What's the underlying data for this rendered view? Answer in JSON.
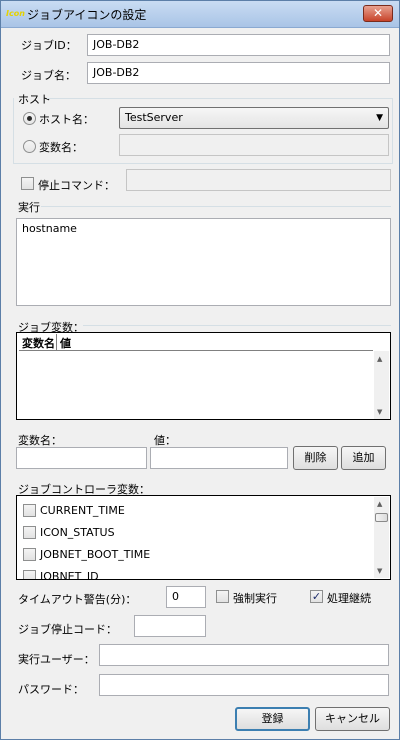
{
  "window": {
    "title": "ジョブアイコンの設定",
    "icon_text": "Icon",
    "close_label": "✕"
  },
  "job_id": {
    "label": "ジョブID：",
    "value": "JOB-DB2"
  },
  "job_name": {
    "label": "ジョブ名：",
    "value": "JOB-DB2"
  },
  "host": {
    "group_label": "ホスト",
    "host_name_label": "ホスト名：",
    "host_name_selected": true,
    "host_name_value": "TestServer",
    "variable_name_label": "変数名：",
    "variable_name_value": ""
  },
  "stop_command": {
    "label": "停止コマンド：",
    "checked": false,
    "value": ""
  },
  "execution": {
    "group_label": "実行",
    "script": "hostname"
  },
  "job_variables": {
    "group_label": "ジョブ変数：",
    "columns": [
      "変数名",
      "値"
    ],
    "rows": [],
    "var_name_label": "変数名：",
    "value_label": "値：",
    "var_name_value": "",
    "value_value": "",
    "delete_label": "削除",
    "add_label": "追加"
  },
  "controller_variables": {
    "group_label": "ジョブコントローラ変数：",
    "items": [
      {
        "label": "CURRENT_TIME",
        "checked": false
      },
      {
        "label": "ICON_STATUS",
        "checked": false
      },
      {
        "label": "JOBNET_BOOT_TIME",
        "checked": false
      },
      {
        "label": "JOBNET_ID",
        "checked": false
      }
    ]
  },
  "timeout": {
    "label": "タイムアウト警告(分)：",
    "value": "0"
  },
  "force_run": {
    "label": "強制実行",
    "checked": false
  },
  "continue_processing": {
    "label": "処理継続",
    "checked": true
  },
  "stop_code": {
    "label": "ジョブ停止コード：",
    "value": ""
  },
  "run_user": {
    "label": "実行ユーザー：",
    "value": ""
  },
  "password": {
    "label": "パスワード：",
    "value": ""
  },
  "buttons": {
    "register_label": "登録",
    "cancel_label": "キャンセル"
  }
}
